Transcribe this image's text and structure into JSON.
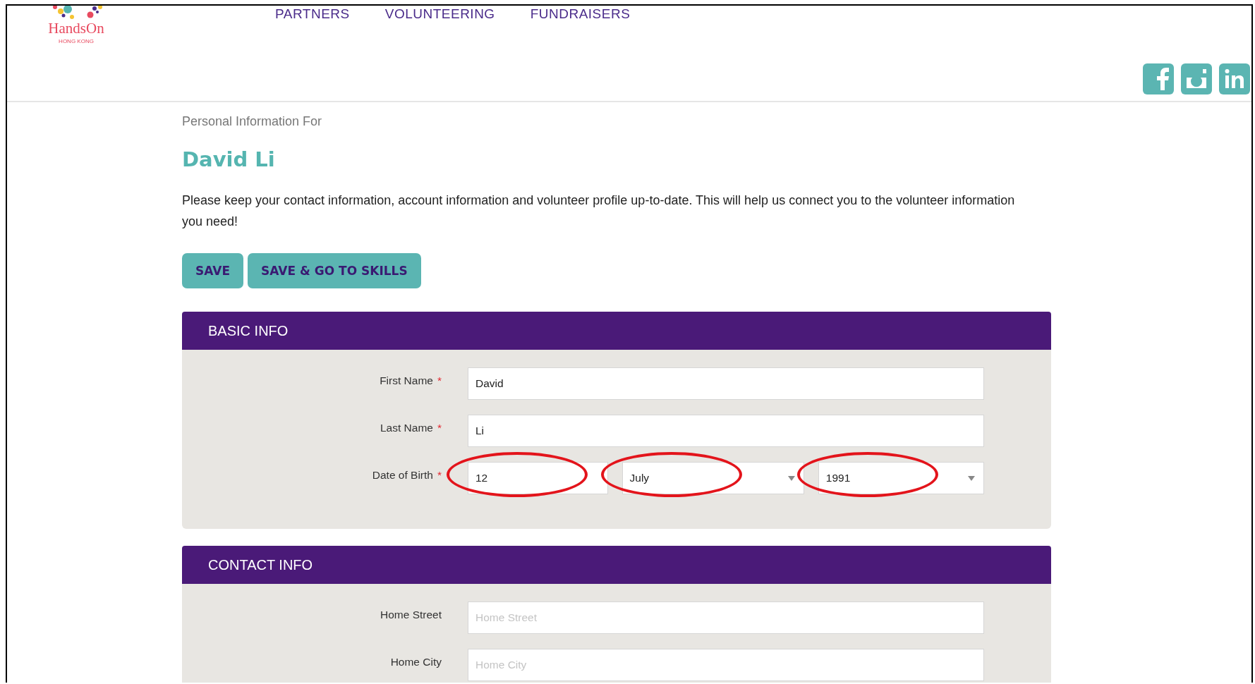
{
  "header": {
    "logo": {
      "name": "HandsOn",
      "sub": "HONG KONG"
    },
    "nav": [
      "PARTNERS",
      "VOLUNTEERING",
      "FUNDRAISERS"
    ],
    "social": [
      {
        "kind": "facebook"
      },
      {
        "kind": "instagram"
      },
      {
        "kind": "linkedin"
      }
    ]
  },
  "intro": {
    "caption": "Personal Information For",
    "name": "David Li",
    "text": "Please keep your contact information, account information and volunteer profile up-to-date. This will help us connect you to the volunteer information you need!"
  },
  "buttons": [
    "SAVE",
    "SAVE & GO TO SKILLS"
  ],
  "sections": [
    {
      "title": "BASIC INFO",
      "rows": [
        {
          "label": "First Name",
          "required_mark": "*",
          "fields": [
            {
              "kind": "text",
              "value": "David",
              "circled": false
            }
          ]
        },
        {
          "label": "Last Name",
          "required_mark": "*",
          "fields": [
            {
              "kind": "text",
              "value": "Li",
              "circled": false
            }
          ]
        },
        {
          "label": "Date of Birth",
          "required_mark": "*",
          "fields": [
            {
              "kind": "text",
              "value": "12",
              "circled": true
            },
            {
              "kind": "select",
              "value": "July",
              "circled": true
            },
            {
              "kind": "select",
              "value": "1991",
              "circled": true
            }
          ]
        }
      ]
    },
    {
      "title": "CONTACT INFO",
      "rows": [
        {
          "label": "Home Street",
          "fields": [
            {
              "kind": "text",
              "placeholder": "Home Street",
              "circled": false
            }
          ]
        },
        {
          "label": "Home City",
          "fields": [
            {
              "kind": "text",
              "placeholder": "Home City",
              "circled": false
            }
          ]
        }
      ]
    }
  ]
}
